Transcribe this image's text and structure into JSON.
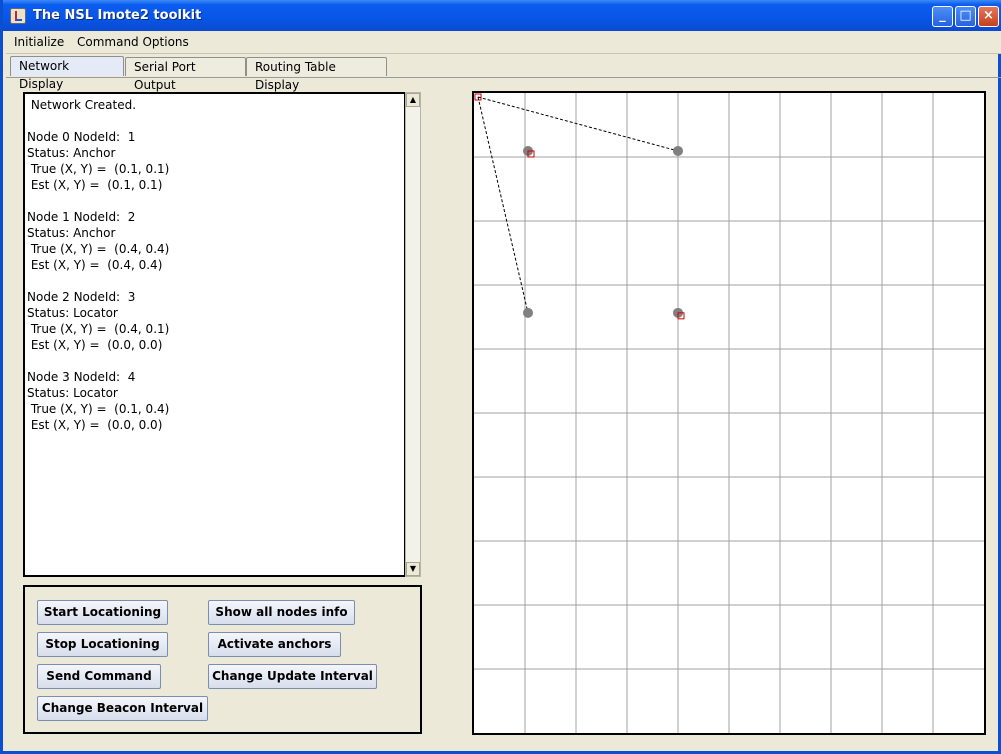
{
  "window": {
    "title": "The NSL Imote2 toolkit"
  },
  "menu": [
    "Initialize",
    "Command Options"
  ],
  "tabs": [
    "Network Display",
    "Serial Port Output",
    "Routing Table Display"
  ],
  "log_lines": [
    " Network Created.",
    "",
    "Node 0 NodeId:  1",
    "Status: Anchor",
    " True (X, Y) =  (0.1, 0.1)",
    " Est (X, Y) =  (0.1, 0.1)",
    "",
    "Node 1 NodeId:  2",
    "Status: Anchor",
    " True (X, Y) =  (0.4, 0.4)",
    " Est (X, Y) =  (0.4, 0.4)",
    "",
    "Node 2 NodeId:  3",
    "Status: Locator",
    " True (X, Y) =  (0.4, 0.1)",
    " Est (X, Y) =  (0.0, 0.0)",
    "",
    "Node 3 NodeId:  4",
    "Status: Locator",
    " True (X, Y) =  (0.1, 0.4)",
    " Est (X, Y) =  (0.0, 0.0)"
  ],
  "buttons": {
    "start_locationing": "Start Locationing",
    "show_all_nodes": "Show all nodes info",
    "stop_locationing": "Stop Locationing",
    "activate_anchors": "Activate anchors",
    "send_command": "Send Command",
    "change_update_interval": "Change Update Interval",
    "change_beacon_interval": "Change Beacon Interval"
  },
  "network": {
    "nodes": [
      {
        "id": 1,
        "status": "Anchor",
        "true_xy": [
          0.1,
          0.1
        ],
        "est_xy": [
          0.1,
          0.1
        ]
      },
      {
        "id": 2,
        "status": "Anchor",
        "true_xy": [
          0.4,
          0.4
        ],
        "est_xy": [
          0.4,
          0.4
        ]
      },
      {
        "id": 3,
        "status": "Locator",
        "true_xy": [
          0.4,
          0.1
        ],
        "est_xy": [
          0.0,
          0.0
        ]
      },
      {
        "id": 4,
        "status": "Locator",
        "true_xy": [
          0.1,
          0.4
        ],
        "est_xy": [
          0.0,
          0.0
        ]
      }
    ],
    "links": [
      [
        0.0,
        0.0,
        0.4,
        0.1
      ],
      [
        0.0,
        0.0,
        0.1,
        0.4
      ]
    ],
    "colors": {
      "node": "#808080",
      "estimate": "#cc0000",
      "grid": "#a0a0a0"
    }
  }
}
